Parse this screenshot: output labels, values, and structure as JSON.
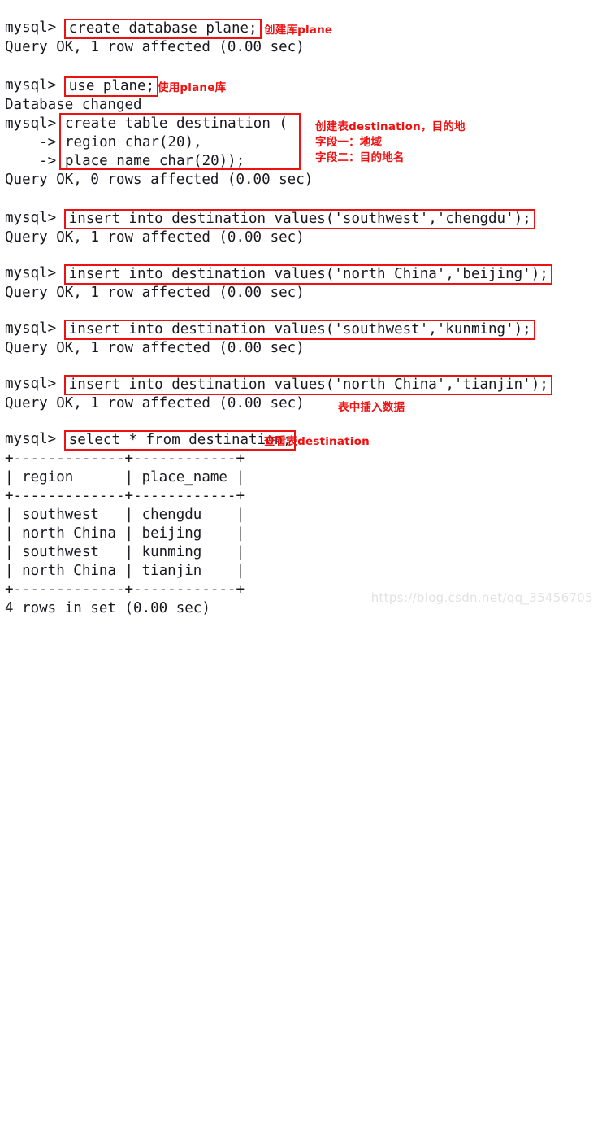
{
  "terminal": {
    "prompt": "mysql>",
    "continuation": "    ->",
    "blocks": [
      {
        "id": "create-database",
        "command": "create database plane;",
        "result": "Query OK, 1 row affected (0.00 sec)"
      },
      {
        "id": "use-database",
        "command": "use plane;",
        "result": "Database changed"
      },
      {
        "id": "create-table",
        "command_line_1": "create table destination (",
        "command_line_2": "region char(20),",
        "command_line_3": "place_name char(20));",
        "result": "Query OK, 0 rows affected (0.00 sec)"
      },
      {
        "id": "insert-chengdu",
        "command": "insert into destination values('southwest','chengdu');",
        "result": "Query OK, 1 row affected (0.00 sec)"
      },
      {
        "id": "insert-beijing",
        "command": "insert into destination values('north China','beijing');",
        "result": "Query OK, 1 row affected (0.00 sec)"
      },
      {
        "id": "insert-kunming",
        "command": "insert into destination values('southwest','kunming');",
        "result": "Query OK, 1 row affected (0.00 sec)"
      },
      {
        "id": "insert-tianjin",
        "command": "insert into destination values('north China','tianjin');",
        "result": "Query OK, 1 row affected (0.00 sec)"
      },
      {
        "id": "select-all",
        "command": "select * from destination;"
      }
    ],
    "result_table": {
      "separator": "+-------------+------------+",
      "header": "| region      | place_name |",
      "rows": [
        "| southwest   | chengdu    |",
        "| north China | beijing    |",
        "| southwest   | kunming    |",
        "| north China | tianjin    |"
      ],
      "footer": "4 rows in set (0.00 sec)"
    }
  },
  "annotations": {
    "create_database": "创建库plane",
    "use_database": "使用plane库",
    "create_table_1": "创建表destination，目的地",
    "create_table_2": "字段一：地域",
    "create_table_3": "字段二：目的地名",
    "insert_data": "表中插入数据",
    "select_data": "查看表destination"
  },
  "watermark": "https://blog.csdn.net/qq_35456705",
  "colors": {
    "annotation_red": "#ee1111",
    "text": "#18181f",
    "background": "#ffffff",
    "watermark": "#e2e2e2"
  }
}
